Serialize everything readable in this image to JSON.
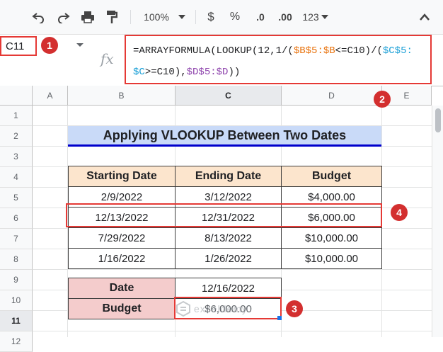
{
  "toolbar": {
    "zoom": "100%",
    "currency": "$",
    "percent": "%",
    "dec_decrease": ".0",
    "dec_increase": ".00",
    "more_formats": "123"
  },
  "namebox": {
    "value": "C11"
  },
  "formula": {
    "line1_pre": "=ARRAYFORMULA(LOOKUP(12,1/(",
    "ref1": "$B$5:$B",
    "op1": "<=C10)/(",
    "ref2": "$C$5:",
    "line2_ref2": "$C",
    "op2": ">=C10),",
    "ref3": "$D$5:$D",
    "end": "))"
  },
  "columns": [
    "A",
    "B",
    "C",
    "D",
    "E"
  ],
  "rows": [
    "1",
    "2",
    "3",
    "4",
    "5",
    "6",
    "7",
    "8",
    "9",
    "10",
    "11",
    "12"
  ],
  "sheet": {
    "title": "Applying VLOOKUP Between Two Dates",
    "headers": [
      "Starting Date",
      "Ending Date",
      "Budget"
    ],
    "data": [
      [
        "2/9/2022",
        "3/12/2022",
        "$4,000.00"
      ],
      [
        "12/13/2022",
        "12/31/2022",
        "$6,000.00"
      ],
      [
        "7/29/2022",
        "8/13/2022",
        "$10,000.00"
      ],
      [
        "1/16/2022",
        "1/26/2022",
        "$10,000.00"
      ]
    ],
    "lookup_label": "Date",
    "lookup_value": "12/16/2022",
    "result_label": "Budget",
    "result_value": "$6,000.00"
  },
  "callouts": [
    "1",
    "2",
    "3",
    "4"
  ],
  "watermark": "exceldemy",
  "colors": {
    "highlight": "#e53935",
    "header_fill": "#fce5cd",
    "label_fill": "#f4cccc",
    "title_fill": "#c9daf8"
  }
}
